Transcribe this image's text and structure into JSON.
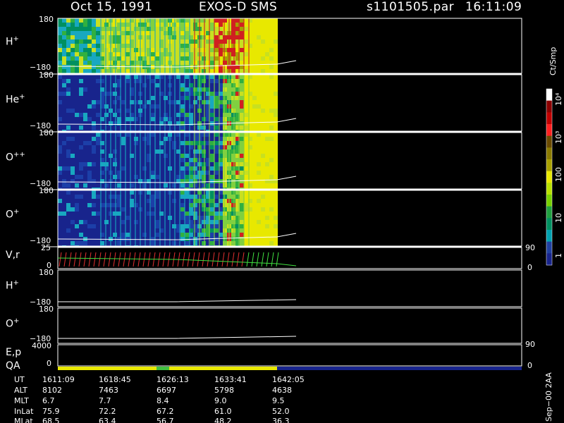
{
  "header": {
    "date": "Oct 15, 1991",
    "instrument": "EXOS-D SMS",
    "file": "s1101505.par",
    "time": "16:11:09"
  },
  "panels": [
    {
      "name": "H+",
      "label": "H",
      "sup": "+",
      "ymax": "180",
      "ymin": "−180"
    },
    {
      "name": "He+",
      "label": "He",
      "sup": "+",
      "ymax": "180",
      "ymin": "−180"
    },
    {
      "name": "O++",
      "label": "O",
      "sup": "++",
      "ymax": "180",
      "ymin": "−180"
    },
    {
      "name": "O+",
      "label": "O",
      "sup": "+",
      "ymax": "180",
      "ymin": "−180"
    },
    {
      "name": "V,r",
      "label": "V,r",
      "sup": "",
      "ymax": "25",
      "ymin": "0",
      "rtop": "90",
      "rbot": "0"
    },
    {
      "name": "H+ line",
      "label": "H",
      "sup": "+",
      "ymax": "180",
      "ymin": "−180"
    },
    {
      "name": "O+ line",
      "label": "O",
      "sup": "+",
      "ymax": "180",
      "ymin": "−180"
    },
    {
      "name": "E,p",
      "label": "E,p",
      "sup": "",
      "ymax": "4000",
      "ymin": "0",
      "rtop": "90",
      "rbot": "0"
    }
  ],
  "qa_label": "QA",
  "colorbar": {
    "unit": "Ct/Smp",
    "ticks": [
      "10⁴",
      "10³",
      "100",
      "10",
      "1"
    ],
    "colors": [
      "#ffffff",
      "#8b0000",
      "#c00000",
      "#ff2020",
      "#6b4b00",
      "#8a7a00",
      "#a8a000",
      "#e8e800",
      "#b8e000",
      "#78d000",
      "#20a040",
      "#009060",
      "#00a0b0",
      "#2040a0",
      "#18248c"
    ]
  },
  "table": {
    "row_labels": [
      "UT",
      "ALT",
      "MLT",
      "InLat",
      "MLat"
    ],
    "columns": [
      [
        "1611:09",
        "8102",
        "6.7",
        "75.9",
        "68.5"
      ],
      [
        "1618:45",
        "7463",
        "7.7",
        "72.2",
        "63.4"
      ],
      [
        "1626:13",
        "6697",
        "8.4",
        "67.2",
        "56.7"
      ],
      [
        "1633:41",
        "5798",
        "9.0",
        "61.0",
        "48.2"
      ],
      [
        "1642:05",
        "4638",
        "9.5",
        "52.0",
        "36.3"
      ]
    ]
  },
  "footer_note": "Sep−00 2AA"
}
